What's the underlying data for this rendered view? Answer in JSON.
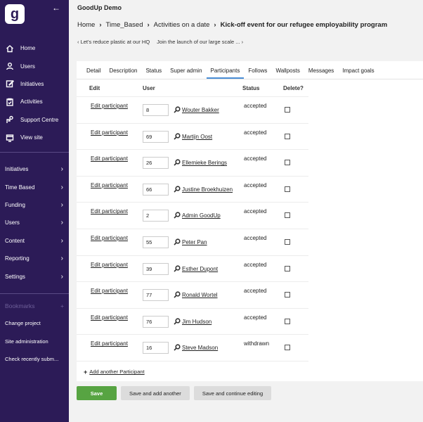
{
  "sidebar": {
    "logo_letter": "g",
    "top_items": [
      {
        "label": "Home",
        "icon": "home-icon"
      },
      {
        "label": "Users",
        "icon": "user-icon"
      },
      {
        "label": "Initiatives",
        "icon": "pencil-icon"
      },
      {
        "label": "Activities",
        "icon": "clipboard-icon"
      },
      {
        "label": "Support Centre",
        "icon": "support-icon"
      },
      {
        "label": "View site",
        "icon": "monitor-icon"
      }
    ],
    "groups": [
      "Initiatives",
      "Time Based",
      "Funding",
      "Users",
      "Content",
      "Reporting",
      "Settings"
    ],
    "bookmarks_label": "Bookmarks",
    "bottom_links": [
      "Change project",
      "Site administration",
      "Check recently subm..."
    ]
  },
  "header": {
    "app_title": "GoodUp Demo",
    "breadcrumb": [
      "Home",
      "Time_Based",
      "Activities on a date"
    ],
    "breadcrumb_current": "Kick-off event for our refugee employability program",
    "prev_label": "Let's reduce plastic at our HQ",
    "next_label": "Join the launch of our large scale ..."
  },
  "tabs": [
    "Detail",
    "Description",
    "Status",
    "Super admin",
    "Participants",
    "Follows",
    "Wallposts",
    "Messages",
    "Impact goals"
  ],
  "active_tab": "Participants",
  "table": {
    "columns": {
      "edit": "Edit",
      "user": "User",
      "status": "Status",
      "delete": "Delete?"
    },
    "edit_link": "Edit participant",
    "rows": [
      {
        "id": "8",
        "user": "Wouter Bakker",
        "status": "accepted"
      },
      {
        "id": "69",
        "user": "Martijn Oost",
        "status": "accepted"
      },
      {
        "id": "26",
        "user": "Ellemieke Berings",
        "status": "accepted"
      },
      {
        "id": "66",
        "user": "Justine Broekhuizen",
        "status": "accepted"
      },
      {
        "id": "2",
        "user": "Admin GoodUp",
        "status": "accepted"
      },
      {
        "id": "55",
        "user": "Peter Pan",
        "status": "accepted"
      },
      {
        "id": "39",
        "user": "Esther Dupont",
        "status": "accepted"
      },
      {
        "id": "77",
        "user": "Ronald Wortel",
        "status": "accepted"
      },
      {
        "id": "76",
        "user": "Jim Hudson",
        "status": "accepted"
      },
      {
        "id": "16",
        "user": "Steve Madson",
        "status": "withdrawn"
      }
    ],
    "add_label": "Add another Participant"
  },
  "actions": {
    "save": "Save",
    "save_add": "Save and add another",
    "save_continue": "Save and continue editing"
  },
  "colors": {
    "sidebar": "#2c1b57",
    "save_button": "#57a442",
    "active_tab": "#4a8ed6"
  }
}
